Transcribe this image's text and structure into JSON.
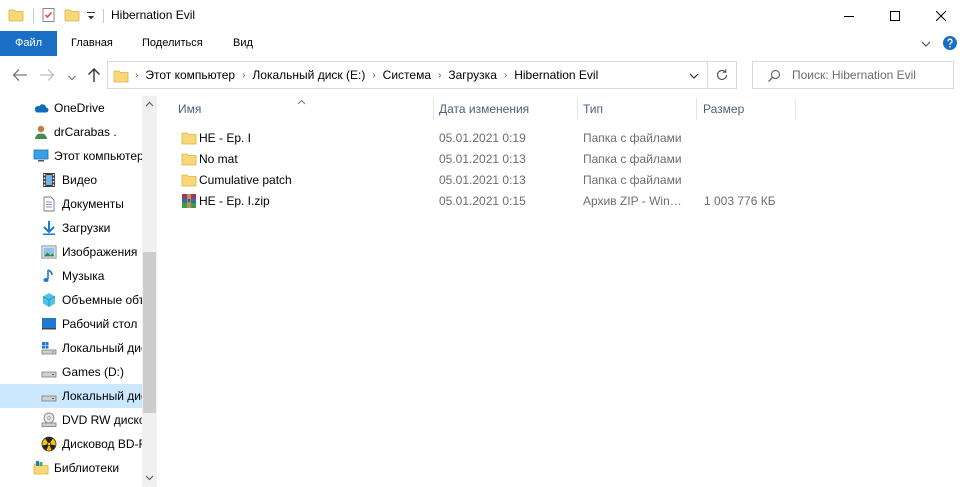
{
  "window": {
    "title": "Hibernation Evil",
    "controls": {
      "minimize": "minimize",
      "maximize": "maximize",
      "close": "close"
    }
  },
  "ribbon": {
    "tabs": [
      {
        "label": "Файл",
        "active": true
      },
      {
        "label": "Главная"
      },
      {
        "label": "Поделиться"
      },
      {
        "label": "Вид"
      }
    ],
    "accent_color": "#1a6fc4"
  },
  "address": {
    "breadcrumbs": [
      "Этот компьютер",
      "Локальный диск (E:)",
      "Система",
      "Загрузка",
      "Hibernation Evil"
    ],
    "separator": "›"
  },
  "search": {
    "placeholder": "Поиск: Hibernation Evil"
  },
  "navigation": {
    "items": [
      {
        "label": "OneDrive",
        "icon": "onedrive-icon"
      },
      {
        "label": "drCarabas .",
        "icon": "user-icon"
      },
      {
        "label": "Этот компьютер",
        "icon": "this-pc-icon"
      },
      {
        "label": "Видео",
        "icon": "video-icon"
      },
      {
        "label": "Документы",
        "icon": "documents-icon"
      },
      {
        "label": "Загрузки",
        "icon": "downloads-icon"
      },
      {
        "label": "Изображения",
        "icon": "pictures-icon"
      },
      {
        "label": "Музыка",
        "icon": "music-icon"
      },
      {
        "label": "Объемные объекты",
        "icon": "3d-objects-icon"
      },
      {
        "label": "Рабочий стол",
        "icon": "desktop-icon"
      },
      {
        "label": "Локальный диск",
        "icon": "system-drive-icon"
      },
      {
        "label": "Games (D:)",
        "icon": "drive-icon"
      },
      {
        "label": "Локальный диск",
        "icon": "drive-icon",
        "selected": true
      },
      {
        "label": "DVD RW дисковод",
        "icon": "dvd-drive-icon"
      },
      {
        "label": "Дисковод BD-ROM",
        "icon": "bd-drive-icon"
      },
      {
        "label": "Библиотеки",
        "icon": "libraries-icon"
      }
    ]
  },
  "filelist": {
    "columns": {
      "name": "Имя",
      "date": "Дата изменения",
      "type": "Тип",
      "size": "Размер"
    },
    "rows": [
      {
        "name": "HE - Ep. I",
        "date": "05.01.2021 0:19",
        "type": "Папка с файлами",
        "size": "",
        "icon": "folder-icon"
      },
      {
        "name": "No mat",
        "date": "05.01.2021 0:13",
        "type": "Папка с файлами",
        "size": "",
        "icon": "folder-icon"
      },
      {
        "name": "Cumulative patch",
        "date": "05.01.2021 0:13",
        "type": "Папка с файлами",
        "size": "",
        "icon": "folder-icon"
      },
      {
        "name": "HE - Ep. I.zip",
        "date": "05.01.2021 0:15",
        "type": "Архив ZIP - WinRAR",
        "size": "1 003 776 КБ",
        "icon": "winrar-archive-icon"
      }
    ]
  }
}
